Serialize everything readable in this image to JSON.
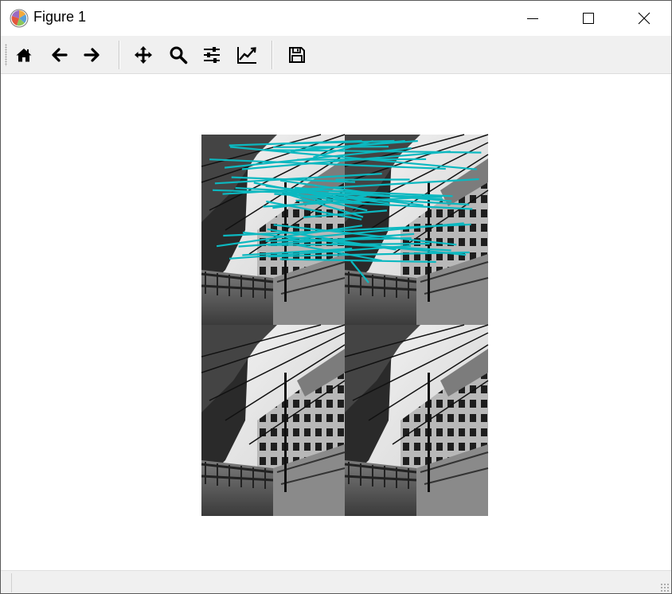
{
  "window": {
    "title": "Figure 1",
    "icons": {
      "app": "matplotlib-icon",
      "minimize": "minimize-icon",
      "maximize": "maximize-icon",
      "close": "close-icon"
    }
  },
  "toolbar": {
    "buttons": [
      {
        "id": "home",
        "icon": "home-icon"
      },
      {
        "id": "back",
        "icon": "arrow-left-icon"
      },
      {
        "id": "forward",
        "icon": "arrow-right-icon"
      },
      {
        "id": "pan",
        "icon": "move-icon"
      },
      {
        "id": "zoom",
        "icon": "zoom-icon"
      },
      {
        "id": "subplots",
        "icon": "sliders-icon"
      },
      {
        "id": "customize",
        "icon": "chart-line-icon"
      },
      {
        "id": "save",
        "icon": "save-icon"
      }
    ]
  },
  "figure": {
    "description_hidden": true,
    "match_line_color": "#0cb8c0"
  },
  "statusbar": {
    "text": ""
  }
}
